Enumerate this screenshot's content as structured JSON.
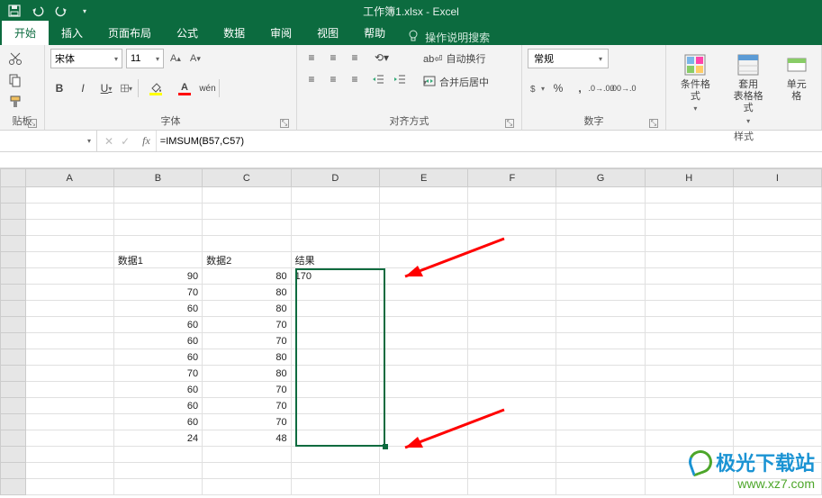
{
  "titlebar": {
    "doc_title": "工作簿1.xlsx - Excel"
  },
  "tabs": {
    "active": "开始",
    "items": [
      "开始",
      "插入",
      "页面布局",
      "公式",
      "数据",
      "审阅",
      "视图",
      "帮助"
    ],
    "tellme": "操作说明搜索"
  },
  "ribbon": {
    "clipboard": {
      "label": "贴板"
    },
    "font": {
      "label": "字体",
      "name": "宋体",
      "size": "11",
      "bold": "B",
      "italic": "I",
      "underline": "U",
      "wen": "wén",
      "fill_color": "#ffff00",
      "font_color": "#ff0000"
    },
    "alignment": {
      "label": "对齐方式",
      "wrap": "自动换行",
      "merge": "合并后居中"
    },
    "number": {
      "label": "数字",
      "format": "常规"
    },
    "styles": {
      "label": "样式",
      "cond": "条件格式",
      "table": "套用\n表格格式",
      "cell": "单元格"
    }
  },
  "namebox": {
    "ref": ""
  },
  "formula": {
    "text": "=IMSUM(B57,C57)"
  },
  "columns": [
    "A",
    "B",
    "C",
    "D",
    "E",
    "F",
    "G",
    "H",
    "I"
  ],
  "grid": {
    "headers": {
      "b": "数据1",
      "c": "数据2",
      "d": "结果"
    },
    "rows": [
      {
        "b": 90,
        "c": 80,
        "d": "170"
      },
      {
        "b": 70,
        "c": 80
      },
      {
        "b": 60,
        "c": 80
      },
      {
        "b": 60,
        "c": 70
      },
      {
        "b": 60,
        "c": 70
      },
      {
        "b": 60,
        "c": 80
      },
      {
        "b": 70,
        "c": 80
      },
      {
        "b": 60,
        "c": 70
      },
      {
        "b": 60,
        "c": 70
      },
      {
        "b": 60,
        "c": 70
      },
      {
        "b": 24,
        "c": 48
      }
    ]
  },
  "chart_data": {
    "type": "table",
    "title": "IMSUM result",
    "columns": [
      "数据1",
      "数据2",
      "结果"
    ],
    "rows": [
      [
        90,
        80,
        170
      ],
      [
        70,
        80,
        null
      ],
      [
        60,
        80,
        null
      ],
      [
        60,
        70,
        null
      ],
      [
        60,
        70,
        null
      ],
      [
        60,
        80,
        null
      ],
      [
        70,
        80,
        null
      ],
      [
        60,
        70,
        null
      ],
      [
        60,
        70,
        null
      ],
      [
        60,
        70,
        null
      ],
      [
        24,
        48,
        null
      ]
    ]
  },
  "watermark": {
    "name": "极光下载站",
    "url": "www.xz7.com"
  }
}
